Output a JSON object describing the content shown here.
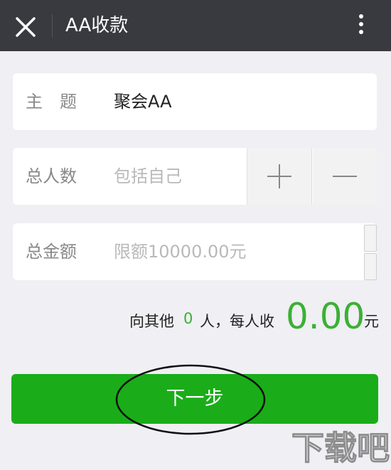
{
  "header": {
    "title": "AA收款",
    "close_icon": "close-icon",
    "more_icon": "more-vertical-icon",
    "bg_color": "#393a3f"
  },
  "form": {
    "topic": {
      "label": "主　题",
      "value": "聚会AA"
    },
    "people": {
      "label": "总人数",
      "placeholder": "包括自己",
      "plus_icon": "plus-icon",
      "minus_icon": "minus-icon"
    },
    "amount": {
      "label": "总金额",
      "placeholder": "限额10000.00元"
    }
  },
  "summary": {
    "prefix": "向其他",
    "count": "0",
    "middle": "人，每人收",
    "amount": "0.00",
    "unit": "元"
  },
  "next_button": {
    "label": "下一步",
    "color": "#1aad19"
  },
  "accent_color": "#3cb034",
  "watermark": {
    "text": "下载吧"
  }
}
